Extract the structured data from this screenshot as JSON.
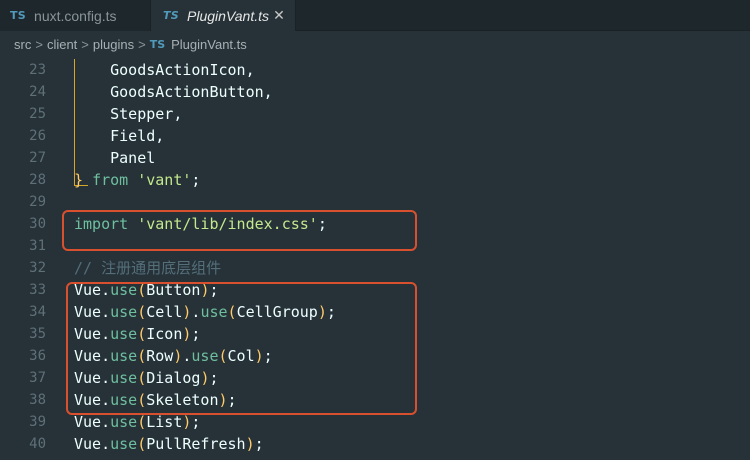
{
  "tabs": [
    {
      "icon": "TS",
      "label": "nuxt.config.ts"
    },
    {
      "icon": "TS",
      "label": "PluginVant.ts",
      "close": "✕"
    }
  ],
  "breadcrumb": {
    "parts": [
      "src",
      "client",
      "plugins"
    ],
    "separator": ">",
    "file_icon": "TS",
    "file": "PluginVant.ts"
  },
  "lines": [
    {
      "num": "23",
      "text": "    GoodsActionIcon,"
    },
    {
      "num": "24",
      "text": "    GoodsActionButton,"
    },
    {
      "num": "25",
      "text": "    Stepper,"
    },
    {
      "num": "26",
      "text": "    Field,"
    },
    {
      "num": "27",
      "text": "    Panel"
    },
    {
      "num": "28",
      "text": "} from 'vant';"
    },
    {
      "num": "29",
      "text": ""
    },
    {
      "num": "30",
      "text": "import 'vant/lib/index.css';"
    },
    {
      "num": "31",
      "text": ""
    },
    {
      "num": "32",
      "text": "// 注册通用底层组件"
    },
    {
      "num": "33",
      "text": "Vue.use(Button);"
    },
    {
      "num": "34",
      "text": "Vue.use(Cell).use(CellGroup);"
    },
    {
      "num": "35",
      "text": "Vue.use(Icon);"
    },
    {
      "num": "36",
      "text": "Vue.use(Row).use(Col);"
    },
    {
      "num": "37",
      "text": "Vue.use(Dialog);"
    },
    {
      "num": "38",
      "text": "Vue.use(Skeleton);"
    },
    {
      "num": "39",
      "text": "Vue.use(List);"
    },
    {
      "num": "40",
      "text": "Vue.use(PullRefresh);"
    }
  ],
  "colors": {
    "editor_bg": "#263238",
    "highlight_box": "#d9502f",
    "string": "#c3e88d",
    "keyword": "#6fbf9f",
    "brace": "#ffcb6b"
  }
}
